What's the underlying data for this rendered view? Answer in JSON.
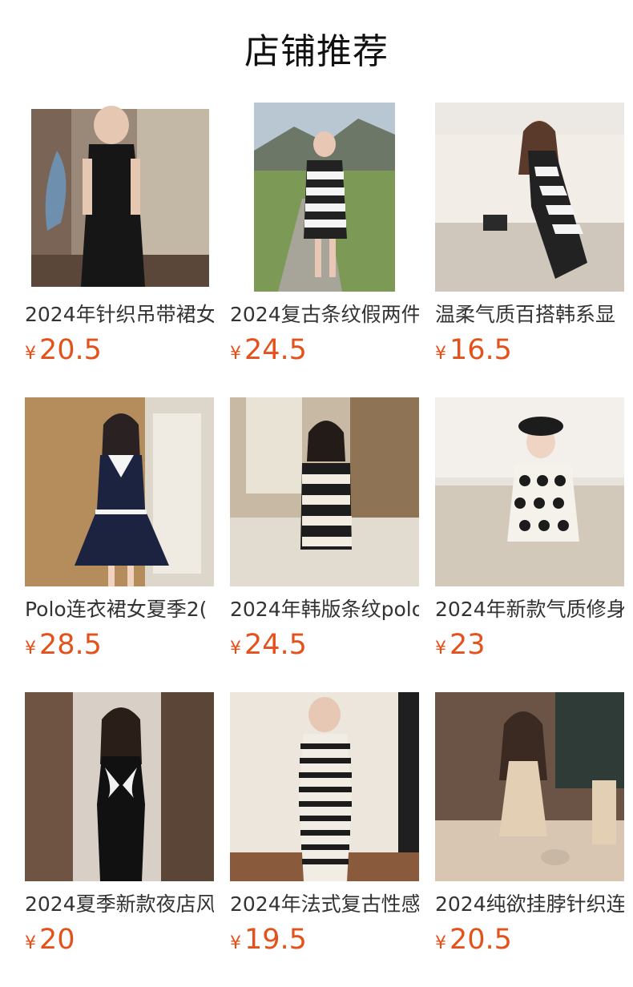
{
  "header": {
    "title": "店铺推荐"
  },
  "currency": "¥",
  "products": [
    {
      "name": "2024年针织吊带裙女",
      "price": "20.5",
      "image": "black-knit-strap-dress-photo"
    },
    {
      "name": "2024复古条纹假两件",
      "price": "24.5",
      "image": "striped-dress-outdoor-photo"
    },
    {
      "name": "温柔气质百搭韩系显",
      "price": "16.5",
      "image": "striped-dress-sofa-photo"
    },
    {
      "name": "Polo连衣裙女夏季2(",
      "price": "28.5",
      "image": "navy-polo-dress-photo"
    },
    {
      "name": "2024年韩版条纹polo",
      "price": "24.5",
      "image": "striped-polo-dress-cafe-photo"
    },
    {
      "name": "2024年新款气质修身",
      "price": "23",
      "image": "heart-pattern-dress-photo"
    },
    {
      "name": "2024夏季新款夜店风",
      "price": "20",
      "image": "black-slip-dress-photo"
    },
    {
      "name": "2024年法式复古性感",
      "price": "19.5",
      "image": "striped-halter-dress-photo"
    },
    {
      "name": "2024纯欲挂脖针织连",
      "price": "20.5",
      "image": "beige-halter-dress-photo"
    }
  ]
}
